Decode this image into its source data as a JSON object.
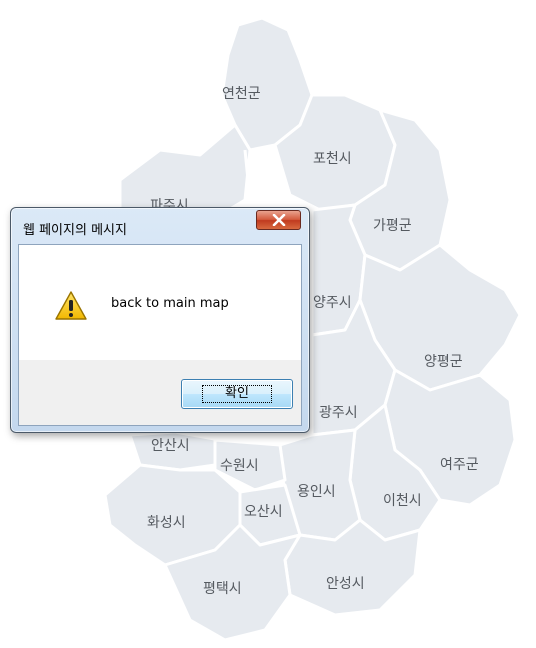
{
  "map": {
    "regions": {
      "yeoncheon": "연천군",
      "pocheon": "포천시",
      "paju": "파주시",
      "gapyeong": "가평군",
      "yangju": "양주시",
      "yangpyeong": "양평군",
      "gwangju": "광주시",
      "ansan": "안산시",
      "suwon": "수원시",
      "yeoju": "여주군",
      "yongin": "용인시",
      "osan": "오산시",
      "icheon": "이천시",
      "hwaseong": "화성시",
      "anseong": "안성시",
      "pyeongtaek": "평택시"
    }
  },
  "dialog": {
    "title": "웹 페이지의 메시지",
    "message": "back to main map",
    "ok_label": "확인",
    "icon": "warning-icon",
    "close_icon": "close-icon"
  }
}
